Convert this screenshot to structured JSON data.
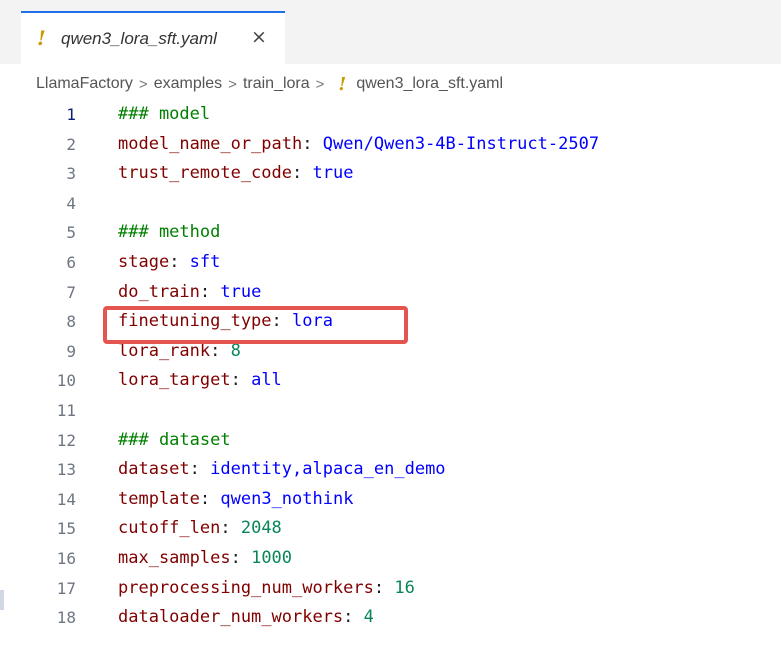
{
  "tab": {
    "file_icon": "!",
    "file_icon_name": "yaml-exclamation-icon",
    "filename": "qwen3_lora_sft.yaml",
    "close": "×"
  },
  "breadcrumb": [
    "LlamaFactory",
    "examples",
    "train_lora"
  ],
  "breadcrumb_file": "qwen3_lora_sft.yaml",
  "breadcrumb_separator": ">",
  "active_line": "1",
  "lines": [
    {
      "n": "1",
      "comment": "### model"
    },
    {
      "n": "2",
      "key": "model_name_or_path",
      "value": "Qwen/Qwen3-4B-Instruct-2507",
      "vtype": "val"
    },
    {
      "n": "3",
      "key": "trust_remote_code",
      "value": "true",
      "vtype": "val"
    },
    {
      "n": "4"
    },
    {
      "n": "5",
      "comment": "### method"
    },
    {
      "n": "6",
      "key": "stage",
      "value": "sft",
      "vtype": "val"
    },
    {
      "n": "7",
      "key": "do_train",
      "value": "true",
      "vtype": "val"
    },
    {
      "n": "8",
      "key": "finetuning_type",
      "value": "lora",
      "vtype": "val"
    },
    {
      "n": "9",
      "key": "lora_rank",
      "value": "8",
      "vtype": "num"
    },
    {
      "n": "10",
      "key": "lora_target",
      "value": "all",
      "vtype": "val"
    },
    {
      "n": "11"
    },
    {
      "n": "12",
      "comment": "### dataset"
    },
    {
      "n": "13",
      "key": "dataset",
      "value": "identity,alpaca_en_demo",
      "vtype": "val"
    },
    {
      "n": "14",
      "key": "template",
      "value": "qwen3_nothink",
      "vtype": "val"
    },
    {
      "n": "15",
      "key": "cutoff_len",
      "value": "2048",
      "vtype": "num"
    },
    {
      "n": "16",
      "key": "max_samples",
      "value": "1000",
      "vtype": "num"
    },
    {
      "n": "17",
      "key": "preprocessing_num_workers",
      "value": "16",
      "vtype": "num"
    },
    {
      "n": "18",
      "key": "dataloader_num_workers",
      "value": "4",
      "vtype": "num"
    }
  ],
  "highlight": {
    "line": "8",
    "color": "#e3564f"
  }
}
